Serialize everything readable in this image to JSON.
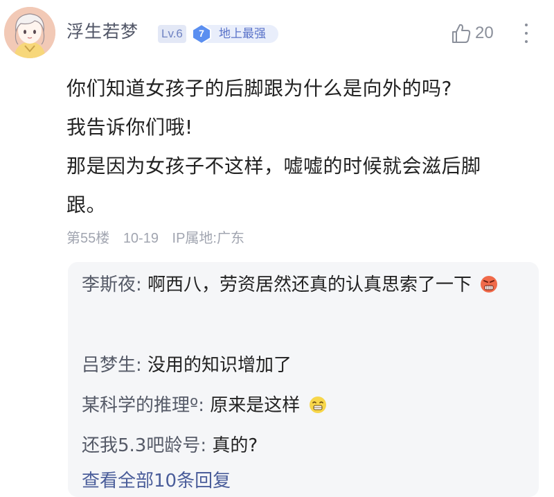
{
  "user": {
    "name": "浮生若梦",
    "level": "Lv.6",
    "title_rank": "7",
    "title": "地上最强"
  },
  "likes": "20",
  "post": {
    "lines": [
      "你们知道女孩子的后脚跟为什么是向外的吗?",
      "我告诉你们哦!",
      "那是因为女孩子不这样，嘘嘘的时候就会滋后脚跟。"
    ]
  },
  "meta": {
    "floor": "第55楼",
    "date": "10-19",
    "ip": "IP属地:广东"
  },
  "replies": [
    {
      "name": "李斯夜:",
      "text": "啊西八，劳资居然还真的认真思索了一下",
      "emoji": "angry-face-emoji"
    },
    {
      "name": "吕梦生:",
      "text": "没用的知识增加了",
      "emoji": ""
    },
    {
      "name": "某科学的推理º:",
      "text": "原来是这样",
      "emoji": "grinning-face-emoji"
    },
    {
      "name": "还我5.3吧龄号:",
      "text": "真的?",
      "emoji": ""
    }
  ],
  "view_all": "查看全部10条回复",
  "colors": {
    "level_badge_bg": "#e3e8f6",
    "title_badge_bg": "#e9eefb",
    "gem_blue": "#5b8ff0",
    "reply_box_bg": "#f5f6f8",
    "link": "#4a5d9a"
  }
}
